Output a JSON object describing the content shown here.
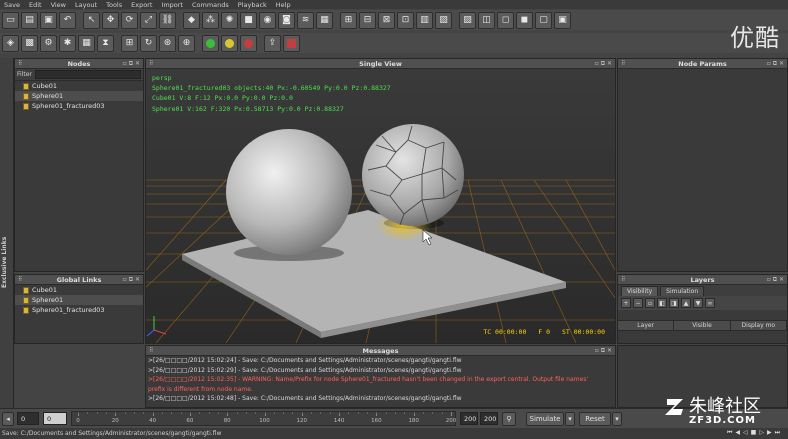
{
  "menu": [
    "Save",
    "Edit",
    "View",
    "Layout",
    "Tools",
    "Export",
    "Import",
    "Commands",
    "Playback",
    "Help"
  ],
  "watermark_top": "优酷",
  "watermark_bottom": {
    "cn": "朱峰社区",
    "en": "ZF3D.COM"
  },
  "side_strip": {
    "label": "Exclusive Links"
  },
  "nodes_panel": {
    "title": "Nodes",
    "filter_label": "Filter",
    "items": [
      "Cube01",
      "Sphere01",
      "Sphere01_fractured03"
    ]
  },
  "global_links_panel": {
    "title": "Global Links",
    "items": [
      "Cube01",
      "Sphere01",
      "Sphere01_fractured03"
    ]
  },
  "viewport_panel": {
    "title": "Single View",
    "camera": "persp",
    "info_lines": [
      "Sphere01_fractured03 objects:40 Px:-0.60549 Py:0.0 Pz:0.88327",
      "Cube01 V:8 F:12 Px:0.0 Py:0.0 Pz:0.0",
      "Sphere01 V:162 F:320 Px:0.58713 Py:0.0 Pz:0.88327"
    ],
    "status": {
      "tc": "TC 00:00:00",
      "frame": "F 0",
      "st": "ST 00:00:00"
    }
  },
  "node_params_panel": {
    "title": "Node Params"
  },
  "layers_panel": {
    "title": "Layers",
    "tabs": [
      "Visibility",
      "Simulation"
    ],
    "columns": [
      "Layer",
      "Visible",
      "Display mo"
    ]
  },
  "messages_panel": {
    "title": "Messages",
    "lines": [
      {
        "text": ">[26/□□□□/2012 15:02:24] - Save: C:/Documents and Settings/Administrator/scenes/gangti/gangti.flw",
        "warn": false
      },
      {
        "text": ">[26/□□□□/2012 15:02:29] - Save: C:/Documents and Settings/Administrator/scenes/gangti/gangti.flw",
        "warn": false
      },
      {
        "text": ">[26/□□□□/2012 15:02:35] - WARNING: Name/Prefix for node Sphere01_fractured hasn't been changed in the export central. Output file names'",
        "warn": true
      },
      {
        "text": "prefix is different from node name.",
        "warn": true
      },
      {
        "text": ">[26/□□□□/2012 15:02:48] - Save: C:/Documents and Settings/Administrator/scenes/gangti/gangti.flw",
        "warn": false
      }
    ]
  },
  "timeline": {
    "start_field": "0",
    "current_field": "0",
    "ruler_labels": [
      "0",
      "20",
      "40",
      "60",
      "80",
      "100",
      "120",
      "140",
      "160",
      "180",
      "200"
    ],
    "end_field_1": "200",
    "end_field_2": "200",
    "simulate_label": "Simulate",
    "reset_label": "Reset"
  },
  "statusbar": {
    "text": "Save: C:/Documents and Settings/Administrator/scenes/gangti/gangti.flw"
  },
  "colors": {
    "hud_green": "#4fe04f",
    "status_yellow": "#ffd400",
    "warning_red": "#ff6060"
  }
}
